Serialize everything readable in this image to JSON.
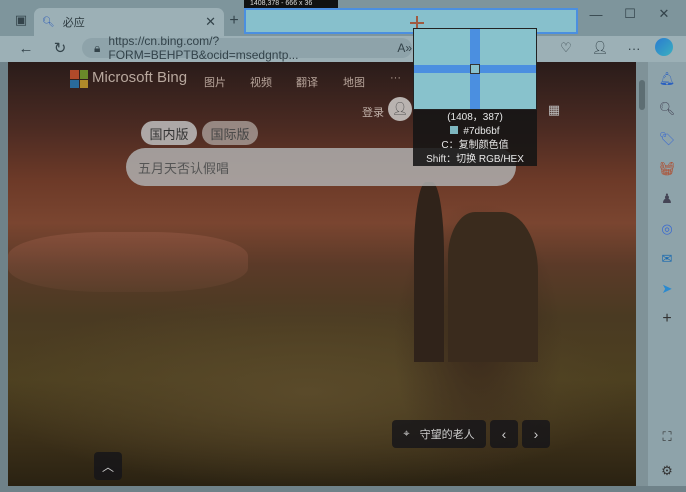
{
  "browser": {
    "tab_title": "必应",
    "url": "https://cn.bing.com/?FORM=BEHPTB&ocid=msedgntp...",
    "read_aloud": "A»"
  },
  "page": {
    "brand": "Microsoft Bing",
    "nav": [
      "图片",
      "视频",
      "翻译",
      "地图",
      "···"
    ],
    "login": "登录",
    "regions": [
      "国内版",
      "国际版"
    ],
    "search_placeholder": "五月天否认假唱",
    "location": "守望的老人"
  },
  "picker": {
    "size_label": "1408,378 - 666 x 36",
    "coords": "(1408，387)",
    "color_hex": "#7db6bf",
    "hint_copy": "C：复制颜色值",
    "hint_toggle": "Shift：切换 RGB/HEX"
  },
  "colors": {
    "picked": "#7db6bf",
    "selection_border": "#4b8fe0"
  }
}
